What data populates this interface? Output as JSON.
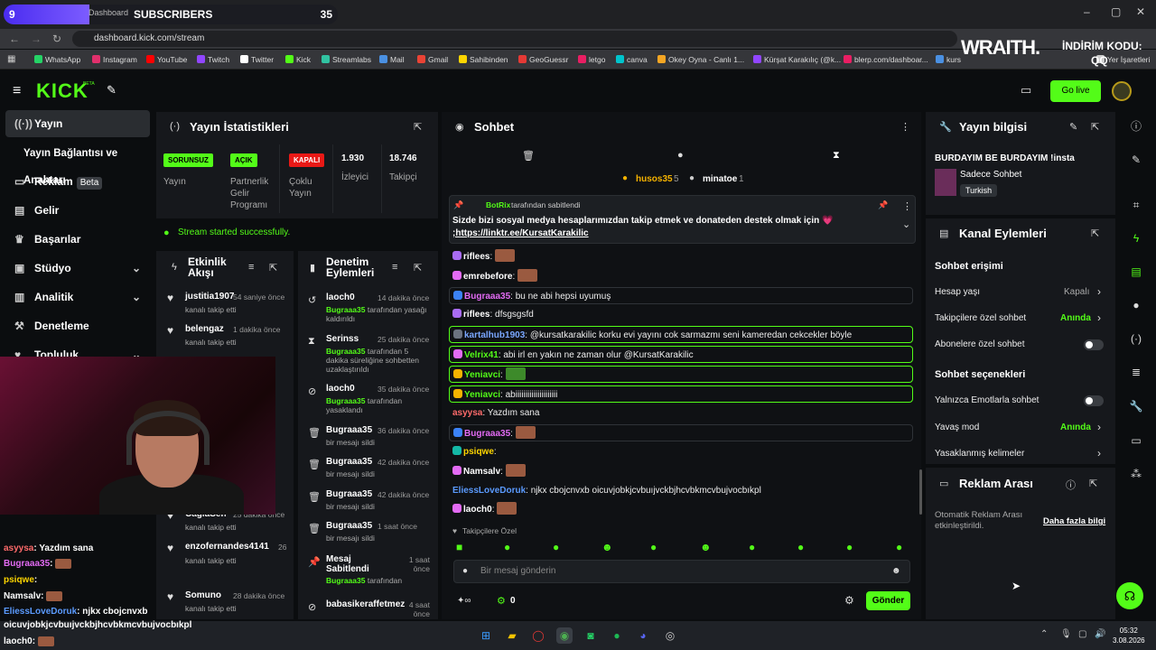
{
  "overlay": {
    "subs_count_left": "9",
    "subs_label": "SUBSCRIBERS",
    "subs_goal": "35",
    "subs_progress": 0.257,
    "tab_text": "Dashboard",
    "sponsor_brand": "WRAITH.",
    "sponsor_line1": "İNDİRİM KODU:",
    "sponsor_line2": "QQ"
  },
  "browser": {
    "url": "dashboard.kick.com/stream",
    "bookmarks": [
      "WhatsApp",
      "Instagram",
      "YouTube",
      "Twitch",
      "Twitter",
      "Kick",
      "Streamlabs",
      "Mail",
      "Gmail",
      "Sahibinden",
      "GeoGuessr",
      "letgo",
      "canva",
      "Okey Oyna - Canlı 1...",
      "Kürşat Karakılıç (@k...",
      "blerp.com/dashboar...",
      "kurs",
      "Yer İşaretleri"
    ],
    "bookmark_colors": [
      "#25d366",
      "#e1306c",
      "#ff0000",
      "#9146ff",
      "#ffffff",
      "#53fc18",
      "#31c3a2",
      "#4a90e2",
      "#ea4335",
      "#ffd600",
      "#e53935",
      "#e91e63",
      "#00c4cc",
      "#f5a623",
      "#9146ff",
      "#e91e63",
      "#4a90e2",
      "#cccccc"
    ]
  },
  "header": {
    "logo": "KICK",
    "beta": "BETA",
    "go_live": "Go live"
  },
  "sidebar": {
    "items": [
      {
        "label": "Yayın",
        "icon": "broadcast-icon"
      },
      {
        "label": "Yayın Bağlantısı ve Anahtarı"
      },
      {
        "label": "Reklam",
        "badge": "Beta",
        "icon": "ad-icon"
      },
      {
        "label": "Gelir",
        "icon": "money-icon"
      },
      {
        "label": "Başarılar",
        "icon": "trophy-icon"
      },
      {
        "label": "Stüdyo",
        "icon": "studio-icon"
      },
      {
        "label": "Analitik",
        "icon": "chart-icon"
      },
      {
        "label": "Denetleme",
        "icon": "hammer-icon"
      },
      {
        "label": "Topluluk",
        "icon": "community-icon"
      }
    ]
  },
  "stats": {
    "title": "Yayın İstatistikleri",
    "tags": [
      "SORUNSUZ",
      "AÇIK",
      "KAPALI"
    ],
    "tag_labels": [
      "Yayın",
      "Partnerlik Gelir Programı",
      "Çoklu Yayın"
    ],
    "viewers": "1.930",
    "viewers_label": "İzleyici",
    "followers": "18.746",
    "followers_label": "Takipçi",
    "success": "Stream started successfully."
  },
  "activity": {
    "title": "Etkinlik Akışı",
    "items": [
      {
        "name": "justitia1907",
        "time": "54 saniye önce",
        "sub": "kanalı takip etti"
      },
      {
        "name": "belengaz",
        "time": "1 dakika önce",
        "sub": "kanalı takip etti"
      },
      {
        "name": "CagiaSen",
        "time": "25 dakika önce",
        "sub": "kanalı takip etti"
      },
      {
        "name": "enzofernandes4141",
        "time": "26 dakika önce",
        "sub": "kanalı takip etti"
      },
      {
        "name": "Somuno",
        "time": "28 dakika önce",
        "sub": "kanalı takip etti"
      }
    ]
  },
  "moderation": {
    "title": "Denetim Eylemleri",
    "items": [
      {
        "name": "laoch0",
        "time": "14 dakika önce",
        "by": "Bugraaa35",
        "sub": "tarafından yasağı kaldırıldı"
      },
      {
        "name": "Serinss",
        "time": "25 dakika önce",
        "by": "Bugraaa35",
        "sub": "tarafından 5 dakika süreliğine sohbetten uzaklaştırıldı"
      },
      {
        "name": "laoch0",
        "time": "35 dakika önce",
        "by": "Bugraaa35",
        "sub": "tarafından yasaklandı"
      },
      {
        "name": "Bugraaa35",
        "time": "36 dakika önce",
        "by": "",
        "sub": "bir mesajı sildi"
      },
      {
        "name": "Bugraaa35",
        "time": "42 dakika önce",
        "by": "",
        "sub": "bir mesajı sildi"
      },
      {
        "name": "Bugraaa35",
        "time": "42 dakika önce",
        "by": "",
        "sub": "bir mesajı sildi"
      },
      {
        "name": "Bugraaa35",
        "time": "1 saat önce",
        "by": "",
        "sub": "bir mesajı sildi"
      },
      {
        "name": "Mesaj Sabitlendi",
        "time": "1 saat önce",
        "by": "Bugraaa35",
        "sub": "tarafından"
      },
      {
        "name": "babasikeraffetmez",
        "time": "4 saat önce",
        "by": "",
        "sub": ""
      }
    ]
  },
  "chat": {
    "title": "Sohbet",
    "top_gifters": [
      {
        "name": "husos35",
        "count": "5"
      },
      {
        "name": "minatoe",
        "count": "1"
      }
    ],
    "pinned_by": "BotRix",
    "pinned_by_suffix": "tarafından sabitlendi",
    "pinned_text": "Sizde bizi sosyal medya hesaplarımızdan takip etmek ve donateden destek olmak için 💗",
    "pinned_link": ";https://linktr.ee/KursatKarakilic",
    "messages": [
      {
        "user": "riflees",
        "color": "#ffffff",
        "text": "",
        "emote": true,
        "style": ""
      },
      {
        "user": "emrebefore",
        "color": "#ffffff",
        "text": "",
        "emote": true,
        "style": ""
      },
      {
        "user": "Bugraaa35",
        "color": "#e36bf4",
        "text": "bu ne abi hepsi uyumuş",
        "emote": false,
        "style": "boxb"
      },
      {
        "user": "riflees",
        "color": "#ffffff",
        "text": "dfsgsgsfd",
        "emote": false,
        "style": ""
      },
      {
        "user": "kartalhub1903",
        "color": "#7aa7ff",
        "text": "@kursatkarakilic korku evi yayını cok sarmazmı seni kameredan cekcekler böyle",
        "emote": false,
        "style": "box"
      },
      {
        "user": "Velrix41",
        "color": "#53fc18",
        "text": "abi irl en yakın ne zaman olur @KursatKarakilic",
        "emote": false,
        "style": "box"
      },
      {
        "user": "Yeniavci",
        "color": "#53fc18",
        "text": "",
        "emote": true,
        "style": "box"
      },
      {
        "user": "Yeniavci",
        "color": "#53fc18",
        "text": "abiiiiiiiiiiiiiiiiiiiii",
        "emote": false,
        "style": "box"
      },
      {
        "user": "asyysa",
        "color": "#ff6b6b",
        "text": "Yazdım sana",
        "emote": false,
        "style": ""
      },
      {
        "user": "Bugraaa35",
        "color": "#e36bf4",
        "text": "",
        "emote": true,
        "style": "boxb"
      },
      {
        "user": "psiqwe",
        "color": "#ffd600",
        "text": "",
        "emote": false,
        "style": ""
      },
      {
        "user": "Namsalv",
        "color": "#ffffff",
        "text": "",
        "emote": true,
        "style": ""
      },
      {
        "user": "EliessLoveDoruk",
        "color": "#5b9bff",
        "text": "njkx cbojcnvxb oicuvjobkjcvbuıjvckbjhcvbkmcvbujvocbıkpl",
        "emote": false,
        "style": ""
      },
      {
        "user": "laoch0",
        "color": "#ffffff",
        "text": "",
        "emote": true,
        "style": ""
      }
    ],
    "follower_only": "Takipçilere Özel",
    "input_placeholder": "Bir mesaj gönderin",
    "points": "0",
    "send": "Gönder"
  },
  "overlay_chat": [
    {
      "user": "asyysa",
      "text": "Yazdım sana",
      "color": "#ff6b6b"
    },
    {
      "user": "Bugraaa35",
      "text": "",
      "color": "#e36bf4"
    },
    {
      "user": "psiqwe",
      "text": "",
      "color": "#ffd600"
    },
    {
      "user": "Namsalv",
      "text": "",
      "color": "#ffffff"
    },
    {
      "user": "EliessLoveDoruk",
      "text": "njkx cbojcnvxb",
      "color": "#5b9bff"
    },
    {
      "user": "",
      "text": "oicuvjobkjcvbuıjvckbjhcvbkmcvbujvocbıkpl",
      "color": "#ffffff"
    },
    {
      "user": "laoch0",
      "text": "",
      "color": "#ffffff"
    }
  ],
  "stream_info": {
    "title": "Yayın bilgisi",
    "stream_title": "BURDAYIM BE BURDAYIM !insta",
    "category": "Sadece Sohbet",
    "language": "Turkish"
  },
  "channel_actions": {
    "title": "Kanal Eylemleri",
    "access_title": "Sohbet erişimi",
    "account_age": "Hesap yaşı",
    "account_age_val": "Kapalı",
    "follower_chat": "Takipçilere özel sohbet",
    "follower_chat_val": "Anında",
    "sub_chat": "Abonelere özel sohbet",
    "options_title": "Sohbet seçenekleri",
    "emote_only": "Yalnızca Emotlarla sohbet",
    "slow_mode": "Yavaş mod",
    "slow_mode_val": "Anında",
    "banned_words": "Yasaklanmış kelimeler"
  },
  "ad_break": {
    "title": "Reklam Arası",
    "text": "Otomatik Reklam Arası etkinleştirildi.",
    "link": "Daha fazla bilgi"
  },
  "taskbar": {
    "time": "05:32",
    "date": "3.08.2026"
  }
}
